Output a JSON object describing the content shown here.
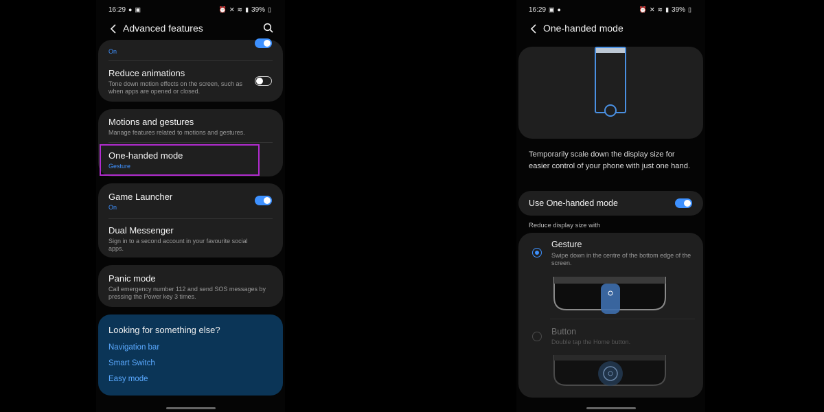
{
  "left": {
    "status": {
      "time": "16:29",
      "battery": "39%"
    },
    "header": {
      "title": "Advanced features"
    },
    "top_partial": {
      "sub": "On"
    },
    "reduce_animations": {
      "title": "Reduce animations",
      "sub": "Tone down motion effects on the screen, such as when apps are opened or closed.",
      "enabled": false
    },
    "motions": {
      "title": "Motions and gestures",
      "sub": "Manage features related to motions and gestures."
    },
    "one_handed": {
      "title": "One-handed mode",
      "sub": "Gesture"
    },
    "game_launcher": {
      "title": "Game Launcher",
      "sub": "On",
      "enabled": true
    },
    "dual_messenger": {
      "title": "Dual Messenger",
      "sub": "Sign in to a second account in your favourite social apps."
    },
    "panic_mode": {
      "title": "Panic mode",
      "sub": "Call emergency number 112 and send SOS messages by pressing the Power key 3 times."
    },
    "looking": {
      "title": "Looking for something else?",
      "links": [
        "Navigation bar",
        "Smart Switch",
        "Easy mode"
      ]
    }
  },
  "right": {
    "status": {
      "time": "16:29",
      "battery": "39%"
    },
    "header": {
      "title": "One-handed mode"
    },
    "description": "Temporarily scale down the display size for easier control of your phone with just one hand.",
    "use_toggle": {
      "label": "Use One-handed mode",
      "enabled": true
    },
    "section_label": "Reduce display size with",
    "options": [
      {
        "title": "Gesture",
        "sub": "Swipe down in the centre of the bottom edge of the screen.",
        "selected": true
      },
      {
        "title": "Button",
        "sub": "Double tap the Home button.",
        "selected": false
      }
    ]
  },
  "colors": {
    "accent": "#3e91ff",
    "highlight": "#b12ccf",
    "card": "#1f1f1f",
    "link_card": "#0b3557"
  }
}
